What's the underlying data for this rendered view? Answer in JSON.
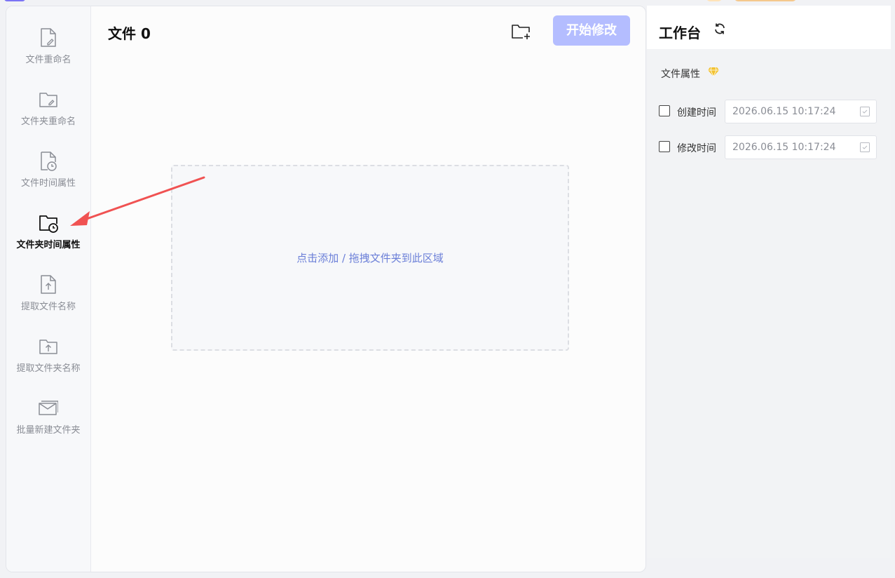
{
  "sidebar": {
    "items": [
      {
        "label": "文件重命名",
        "icon": "file-rename-icon",
        "active": false
      },
      {
        "label": "文件夹重命名",
        "icon": "folder-rename-icon",
        "active": false
      },
      {
        "label": "文件时间属性",
        "icon": "file-time-icon",
        "active": false
      },
      {
        "label": "文件夹时间属性",
        "icon": "folder-time-icon",
        "active": true
      },
      {
        "label": "提取文件名称",
        "icon": "file-extract-icon",
        "active": false
      },
      {
        "label": "提取文件夹名称",
        "icon": "folder-extract-icon",
        "active": false
      },
      {
        "label": "批量新建文件夹",
        "icon": "batch-folder-icon",
        "active": false
      }
    ]
  },
  "main": {
    "title": "文件 0",
    "add_folder_icon": "add-folder-icon",
    "start_button": "开始修改",
    "dropzone_text": "点击添加 / 拖拽文件夹到此区域"
  },
  "workbench": {
    "title": "工作台",
    "refresh_icon": "refresh-icon",
    "section_label": "文件属性",
    "section_icon": "gem-icon",
    "rows": [
      {
        "label": "创建时间",
        "value": "2026.06.15 10:17:24",
        "checked": false
      },
      {
        "label": "修改时间",
        "value": "2026.06.15 10:17:24",
        "checked": false
      }
    ]
  },
  "colors": {
    "accent": "#b4bdff",
    "link": "#6b7fd8",
    "annotation_arrow": "#f05252",
    "gem": "#f2c230"
  }
}
